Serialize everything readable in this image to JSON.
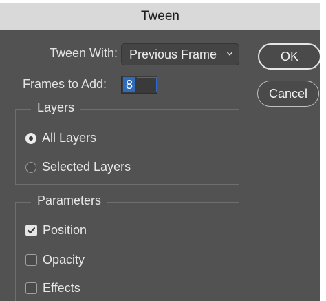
{
  "window": {
    "title": "Tween"
  },
  "tween_with": {
    "label": "Tween With:",
    "value": "Previous Frame"
  },
  "frames_to_add": {
    "label": "Frames to Add:",
    "value": "8"
  },
  "buttons": {
    "ok": "OK",
    "cancel": "Cancel"
  },
  "layers": {
    "title": "Layers",
    "options": [
      {
        "label": "All Layers",
        "selected": true
      },
      {
        "label": "Selected Layers",
        "selected": false
      }
    ]
  },
  "parameters": {
    "title": "Parameters",
    "options": [
      {
        "label": "Position",
        "checked": true
      },
      {
        "label": "Opacity",
        "checked": false
      },
      {
        "label": "Effects",
        "checked": false
      }
    ]
  },
  "colors": {
    "dialog_bg": "#525252",
    "titlebar_bg": "#d9d9d9",
    "selection": "#2f6bbd"
  }
}
